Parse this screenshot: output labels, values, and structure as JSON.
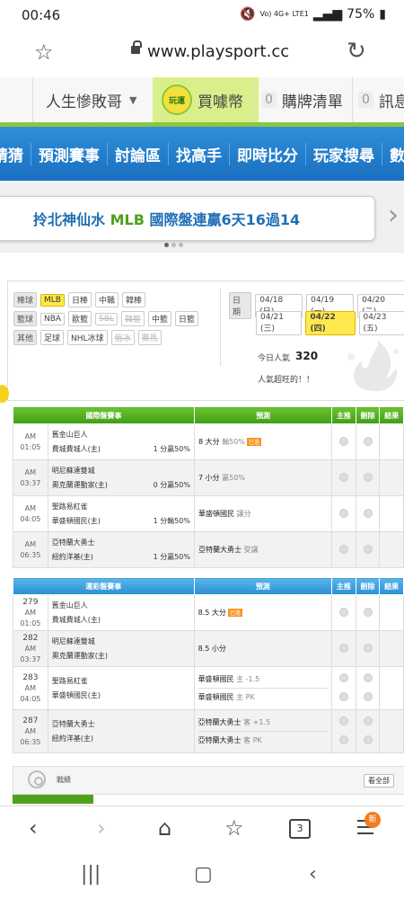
{
  "status": {
    "time": "00:46",
    "net": "Vo) 4G+ LTE1",
    "battery": "75%"
  },
  "browser": {
    "url": "www.playsport.cc",
    "tab_count": "3",
    "new_badge": "新"
  },
  "site_bar": {
    "user": "人生慘敗哥",
    "coin_icon": "玩運",
    "coin": "買噱幣",
    "cart_count": "0",
    "cart": "購牌清單",
    "msg_count": "0",
    "msg": "訊息"
  },
  "nav": [
    "猜猜",
    "預測賽事",
    "討論區",
    "找高手",
    "即時比分",
    "玩家搜尋",
    "數據"
  ],
  "banner": {
    "prefix": "拎北神仙水 ",
    "highlight": "MLB",
    "suffix": " 國際盤連贏6天16過14"
  },
  "filter": {
    "baseball_tag": "棒球",
    "baseball": [
      "MLB",
      "日棒",
      "中職",
      "韓棒"
    ],
    "basketball_tag": "籃球",
    "basketball": [
      "NBA",
      "歐籃",
      "SBL",
      "韓籃",
      "中籃",
      "日籃"
    ],
    "other_tag": "其他",
    "other": [
      "足球",
      "NHL冰球",
      "俄冰",
      "賽馬"
    ],
    "date_tag": "日期",
    "dates": [
      "04/18 (日)",
      "04/19 (一)",
      "04/20 (二)",
      "04/21 (三)",
      "04/22 (四)",
      "04/23 (五)"
    ],
    "popularity_label": "今日人氣",
    "popularity": "320",
    "popularity_msg": "人氣超旺的！！"
  },
  "intl_table": {
    "headers": [
      "國際盤賽事",
      "預測",
      "主推",
      "刪除",
      "結果"
    ],
    "rows": [
      {
        "time": "AM 01:05",
        "away": "舊金山巨人",
        "home": "費城費城人(主)",
        "line": "1 分贏50%",
        "pred": "8 大分",
        "pred_sub": "輸50%",
        "stamp": "已過"
      },
      {
        "time": "AM 03:37",
        "away": "明尼蘇達雙城",
        "home": "奧克蘭運動家(主)",
        "line": "0 分贏50%",
        "pred": "7 小分",
        "pred_sub": "贏50%"
      },
      {
        "time": "AM 04:05",
        "away": "聖路易紅雀",
        "home": "華盛頓國民(主)",
        "line": "1 分輸50%",
        "pred": "華盛頓國民",
        "pred_sub": "讓分"
      },
      {
        "time": "AM 06:35",
        "away": "亞特蘭大勇士",
        "home": "紐約洋基(主)",
        "line": "1 分贏50%",
        "pred": "亞特蘭大勇士",
        "pred_sub": "受讓"
      }
    ]
  },
  "lottery_table": {
    "headers": [
      "運彩盤賽事",
      "預測",
      "主推",
      "刪除",
      "結果"
    ],
    "rows": [
      {
        "num": "279",
        "time": "AM 01:05",
        "away": "舊金山巨人",
        "home": "費城費城人(主)",
        "preds": [
          {
            "pred": "8.5 大分",
            "sub": "",
            "stamp": "已過"
          }
        ]
      },
      {
        "num": "282",
        "time": "AM 03:37",
        "away": "明尼蘇達雙城",
        "home": "奧克蘭運動家(主)",
        "preds": [
          {
            "pred": "8.5 小分",
            "sub": ""
          }
        ]
      },
      {
        "num": "283",
        "time": "AM 04:05",
        "away": "聖路易紅雀",
        "home": "華盛頓國民(主)",
        "preds": [
          {
            "pred": "華盛頓國民",
            "sub": "主 -1.5"
          },
          {
            "pred": "華盛頓國民",
            "sub": "主 PK"
          }
        ]
      },
      {
        "num": "287",
        "time": "AM 06:35",
        "away": "亞特蘭大勇士",
        "home": "紐約洋基(主)",
        "preds": [
          {
            "pred": "亞特蘭大勇士",
            "sub": "客 +1.5"
          },
          {
            "pred": "亞特蘭大勇士",
            "sub": "客 PK"
          }
        ]
      }
    ]
  },
  "record": {
    "label": "戰績",
    "view_all": "看全部"
  },
  "colors": {
    "green": "#4ea21a",
    "blue": "#1a6fc0",
    "yellow": "#ffe94d",
    "orange": "#f07d1e"
  }
}
